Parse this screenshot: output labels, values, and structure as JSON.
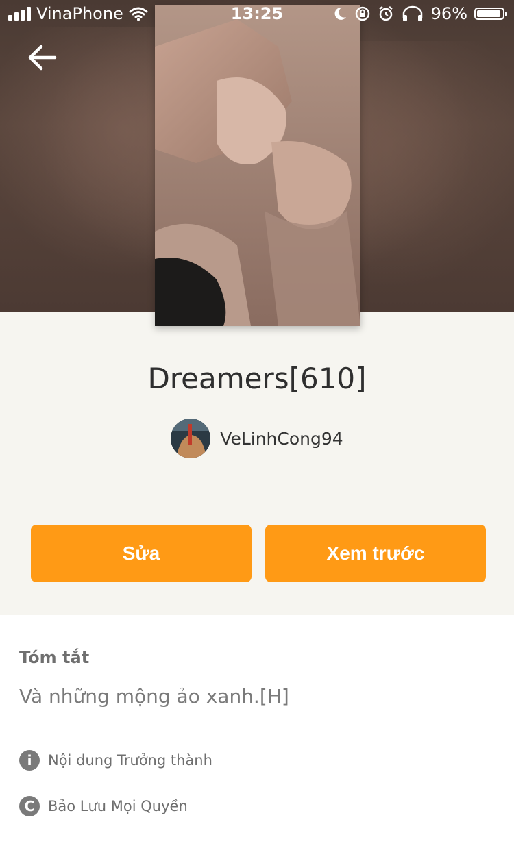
{
  "status_bar": {
    "carrier": "VinaPhone",
    "time": "13:25",
    "battery_percent": "96%",
    "icons": [
      "signal-icon",
      "wifi-icon",
      "moon-icon",
      "rotation-lock-icon",
      "alarm-icon",
      "headphones-icon",
      "battery-icon"
    ]
  },
  "header": {
    "back_icon": "arrow-left-icon"
  },
  "story": {
    "title": "Dreamers[610]",
    "author": "VeLinhCong94"
  },
  "actions": {
    "edit_label": "Sửa",
    "preview_label": "Xem trước"
  },
  "summary": {
    "heading": "Tóm tắt",
    "text": "Và những mộng ảo xanh.[H]",
    "mature_label": "Nội dung Trưởng thành",
    "rights_label": "Bảo Lưu Mọi Quyền"
  },
  "colors": {
    "accent": "#ff9a15",
    "background": "#f6f5f0",
    "panel": "#ffffff"
  }
}
